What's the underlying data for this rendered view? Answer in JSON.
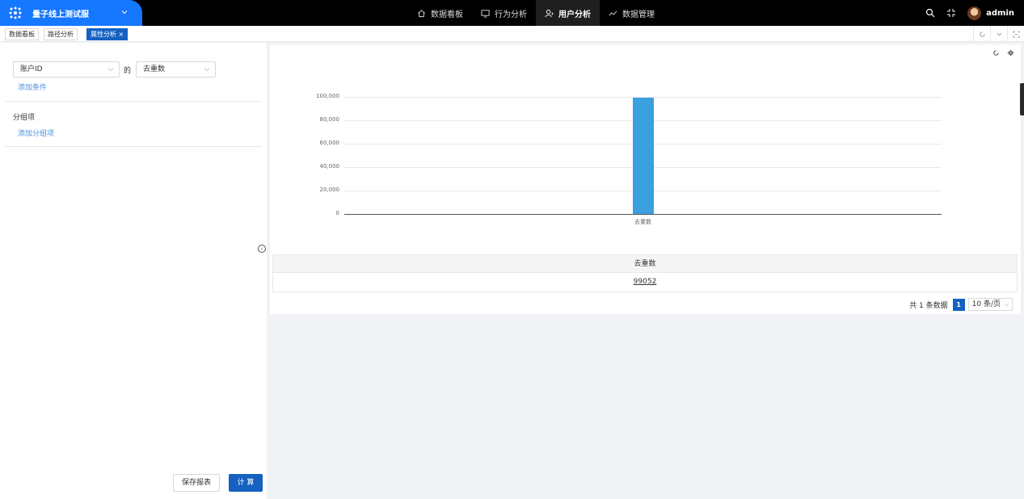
{
  "topbar": {
    "project": "量子线上测试服",
    "nav": [
      {
        "label": "数据看板",
        "icon": "home-icon",
        "active": false
      },
      {
        "label": "行为分析",
        "icon": "monitor-icon",
        "active": false
      },
      {
        "label": "用户分析",
        "icon": "user-icon",
        "active": true
      },
      {
        "label": "数据管理",
        "icon": "trend-icon",
        "active": false
      }
    ],
    "username": "admin"
  },
  "tabs": {
    "items": [
      {
        "label": "数据看板",
        "active": false
      },
      {
        "label": "路径分析",
        "active": false
      },
      {
        "label": "属性分析 ×",
        "active": true
      }
    ]
  },
  "left": {
    "property_select": "账户ID",
    "of_label": "的",
    "metric_select": "去重数",
    "add_condition": "添加条件",
    "group_label": "分组项",
    "add_group": "添加分组项",
    "save_button": "保存报表",
    "calc_button": "计 算"
  },
  "chart_data": {
    "type": "bar",
    "categories": [
      "去重数"
    ],
    "values": [
      99052
    ],
    "ylim": [
      0,
      100000
    ],
    "yticks": [
      "0",
      "20,000",
      "40,000",
      "60,000",
      "80,000",
      "100,000"
    ],
    "grid": true,
    "bar_color": "#3aa0de"
  },
  "table": {
    "header": "去重数",
    "value": "99052"
  },
  "pager": {
    "total_text": "共 1 条数据",
    "current_page": "1",
    "page_size": "10 条/页"
  },
  "colors": {
    "brand": "#1677ff",
    "primary": "#1561c2",
    "link": "#4a90e2"
  }
}
